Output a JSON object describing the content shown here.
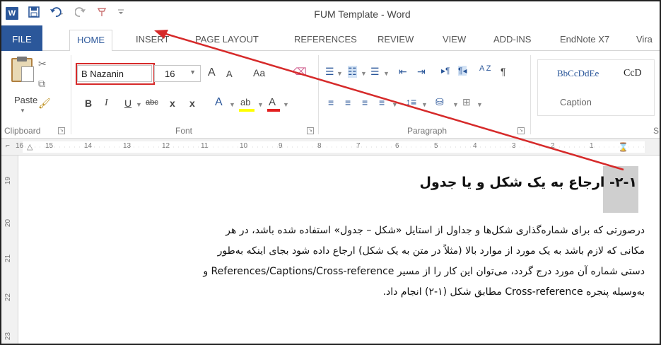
{
  "window": {
    "title": "FUM Template - Word",
    "app_icon": "W"
  },
  "quick_access": {
    "icons": [
      "word-icon",
      "save-icon",
      "undo-icon",
      "redo-icon",
      "customize-icon"
    ]
  },
  "tabs": [
    {
      "label": "FILE"
    },
    {
      "label": "HOME"
    },
    {
      "label": "INSERT"
    },
    {
      "label": "PAGE LAYOUT"
    },
    {
      "label": "REFERENCES"
    },
    {
      "label": "REVIEW"
    },
    {
      "label": "VIEW"
    },
    {
      "label": "ADD-INS"
    },
    {
      "label": "EndNote X7"
    },
    {
      "label": "Vira"
    }
  ],
  "ribbon": {
    "clipboard": {
      "paste_label": "Paste",
      "group_label": "Clipboard"
    },
    "font": {
      "font_name": "B Nazanin",
      "font_size": "16",
      "grow_label": "A",
      "shrink_label": "A",
      "case_label": "Aa",
      "bold": "B",
      "italic": "I",
      "underline": "U",
      "strike": "abc",
      "subscript": "x",
      "superscript": "x",
      "effects": "A",
      "highlight": "ab",
      "font_color": "A",
      "group_label": "Font"
    },
    "paragraph": {
      "group_label": "Paragraph",
      "sort_label": "A Z",
      "pilcrow": "¶"
    },
    "styles": {
      "sample1": "BbCcDdEe",
      "name1": "Caption",
      "sample2": "CcD",
      "group_label": "S"
    }
  },
  "ruler": {
    "numbers": [
      "16",
      "15",
      "14",
      "13",
      "12",
      "11",
      "10",
      "9",
      "8",
      "7",
      "6",
      "5",
      "4",
      "3",
      "2",
      "1"
    ],
    "vertical": [
      "19",
      "20",
      "21",
      "22",
      "23"
    ]
  },
  "document": {
    "heading_number": "۲-۱",
    "heading_text": "- ارجاع به یک شکل و یا جدول",
    "lines": [
      "درصورتی که برای شماره‌گذاری شکل‌ها و جداول از استایل «شکل – جدول» استفاده شده باشد، در هر",
      "مکانی که لازم باشد به یک مورد از موارد بالا (مثلاً در متن به یک شکل) ارجاع داده شود بجای اینکه به‌طور",
      "دستی شماره آن مورد درج گردد، می‌توان این کار را از مسیر References/Captions/Cross-reference و",
      "به‌وسیله پنجره Cross-reference مطابق شکل (۱-۲) انجام داد."
    ]
  },
  "colors": {
    "accent": "#2b579a",
    "annotation": "#d62a2a"
  }
}
